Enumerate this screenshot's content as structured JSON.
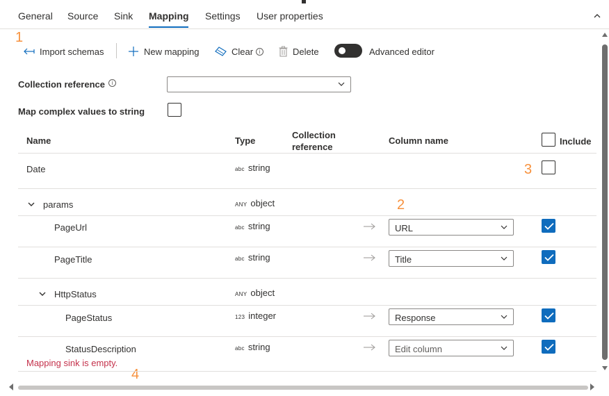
{
  "tabs": [
    {
      "label": "General"
    },
    {
      "label": "Source"
    },
    {
      "label": "Sink"
    },
    {
      "label": "Mapping"
    },
    {
      "label": "Settings"
    },
    {
      "label": "User properties"
    }
  ],
  "active_tab": "Mapping",
  "annotations": [
    "1",
    "2",
    "3",
    "4"
  ],
  "toolbar": {
    "import_schemas": "Import schemas",
    "new_mapping": "New mapping",
    "clear": "Clear",
    "delete": "Delete",
    "advanced_editor": "Advanced editor",
    "advanced_editor_on": false
  },
  "collection_reference_field": {
    "label": "Collection reference",
    "value": ""
  },
  "map_complex": {
    "label": "Map complex values to string",
    "checked": false
  },
  "table": {
    "headers": {
      "name": "Name",
      "type": "Type",
      "collection_reference_line1": "Collection",
      "collection_reference_line2": "reference",
      "column_name": "Column name",
      "include": "Include"
    },
    "rows": [
      {
        "name": "Date",
        "type_badge": "abc",
        "type": "string",
        "column": "",
        "included": false
      },
      {
        "name": "params",
        "type_badge": "ANY",
        "type": "object",
        "expanded": true
      },
      {
        "name": "PageUrl",
        "type_badge": "abc",
        "type": "string",
        "column": "URL",
        "included": true
      },
      {
        "name": "PageTitle",
        "type_badge": "abc",
        "type": "string",
        "column": "Title",
        "included": true
      },
      {
        "name": "HttpStatus",
        "type_badge": "ANY",
        "type": "object",
        "expanded": true
      },
      {
        "name": "PageStatus",
        "type_badge": "123",
        "type": "integer",
        "column": "Response",
        "included": true
      },
      {
        "name": "StatusDescription",
        "type_badge": "abc",
        "type": "string",
        "column": "Edit column",
        "included": true
      }
    ]
  },
  "error_message": "Mapping sink is empty.",
  "colors": {
    "accent": "#0f6cbd",
    "annotation": "#f7913d",
    "error": "#c4314b"
  }
}
